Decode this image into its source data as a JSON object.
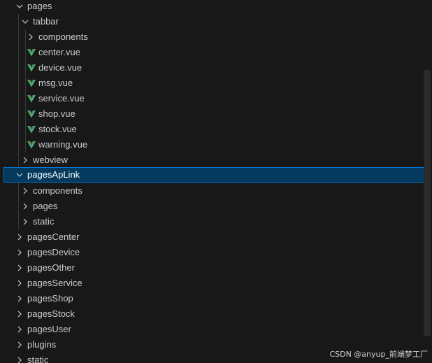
{
  "tree": {
    "pages": "pages",
    "tabbar": "tabbar",
    "tabbar_components": "components",
    "files": [
      "center.vue",
      "device.vue",
      "msg.vue",
      "service.vue",
      "shop.vue",
      "stock.vue",
      "warning.vue"
    ],
    "webview": "webview",
    "pagesApLink": "pagesApLink",
    "aplink_children": [
      "components",
      "pages",
      "static"
    ],
    "folders": [
      "pagesCenter",
      "pagesDevice",
      "pagesOther",
      "pagesService",
      "pagesShop",
      "pagesStock",
      "pagesUser",
      "plugins",
      "static"
    ]
  },
  "watermark": "CSDN @anyup_前端梦工厂",
  "colors": {
    "vue_green": "#41b883",
    "selection_bg": "#04395e",
    "selection_border": "#0078d4"
  },
  "icons": {
    "folder_open": "chevron-down-icon",
    "folder_closed": "chevron-right-icon",
    "vue_file": "vue-icon"
  }
}
